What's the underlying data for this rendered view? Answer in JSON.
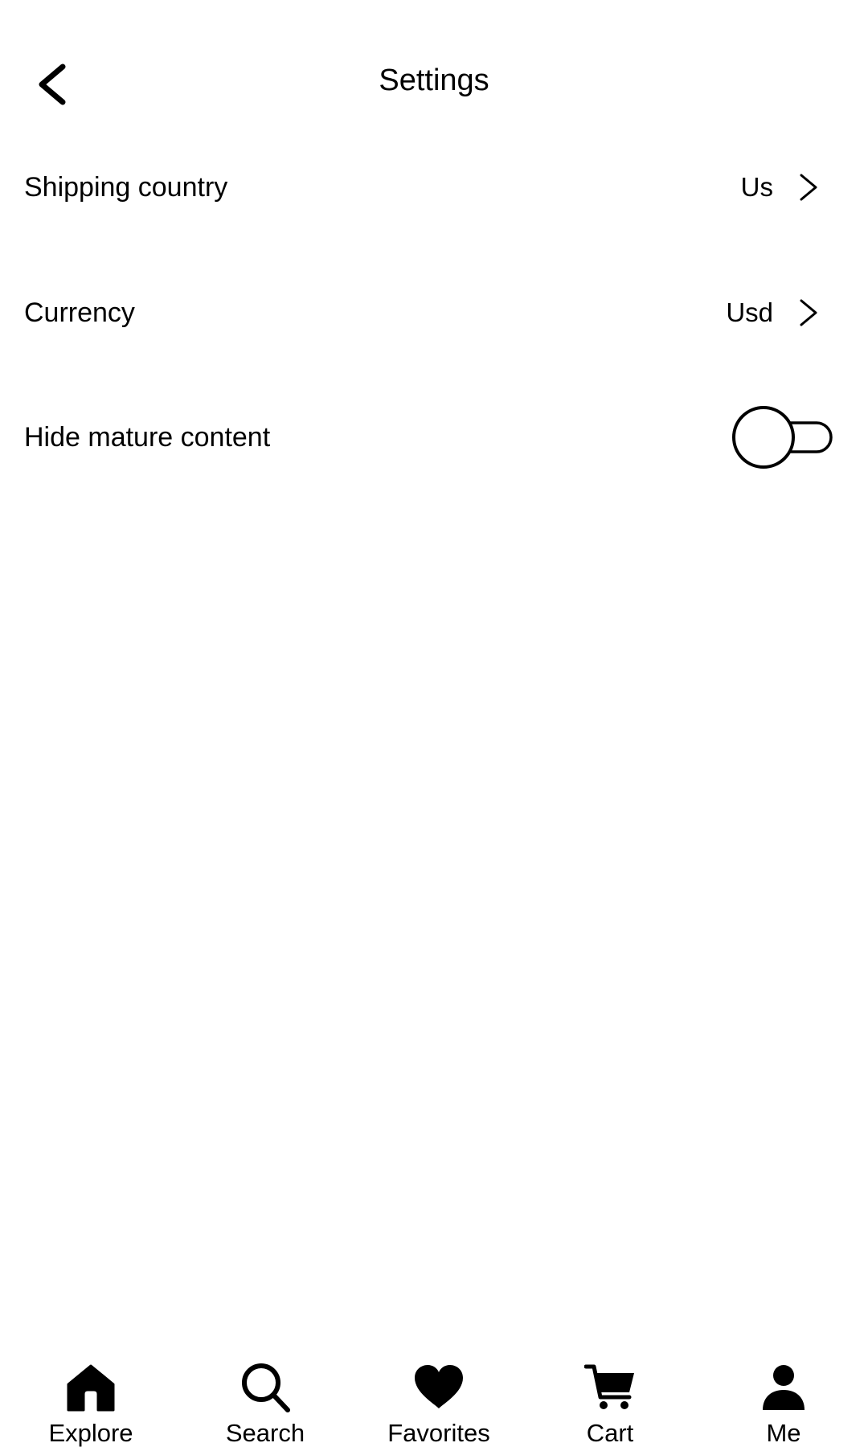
{
  "header": {
    "title": "Settings",
    "back_icon": "chevron-left-icon"
  },
  "settings": {
    "shipping_country": {
      "label": "Shipping country",
      "value": "Us",
      "icon": "chevron-right-icon"
    },
    "currency": {
      "label": "Currency",
      "value": "Usd",
      "icon": "chevron-right-icon"
    },
    "hide_mature_content": {
      "label": "Hide mature content",
      "enabled": false
    }
  },
  "tabbar": {
    "items": [
      {
        "label": "Explore",
        "icon": "home-icon"
      },
      {
        "label": "Search",
        "icon": "search-icon"
      },
      {
        "label": "Favorites",
        "icon": "heart-icon"
      },
      {
        "label": "Cart",
        "icon": "cart-icon"
      },
      {
        "label": "Me",
        "icon": "person-icon"
      }
    ]
  },
  "colors": {
    "foreground": "#000000",
    "background": "#ffffff"
  }
}
